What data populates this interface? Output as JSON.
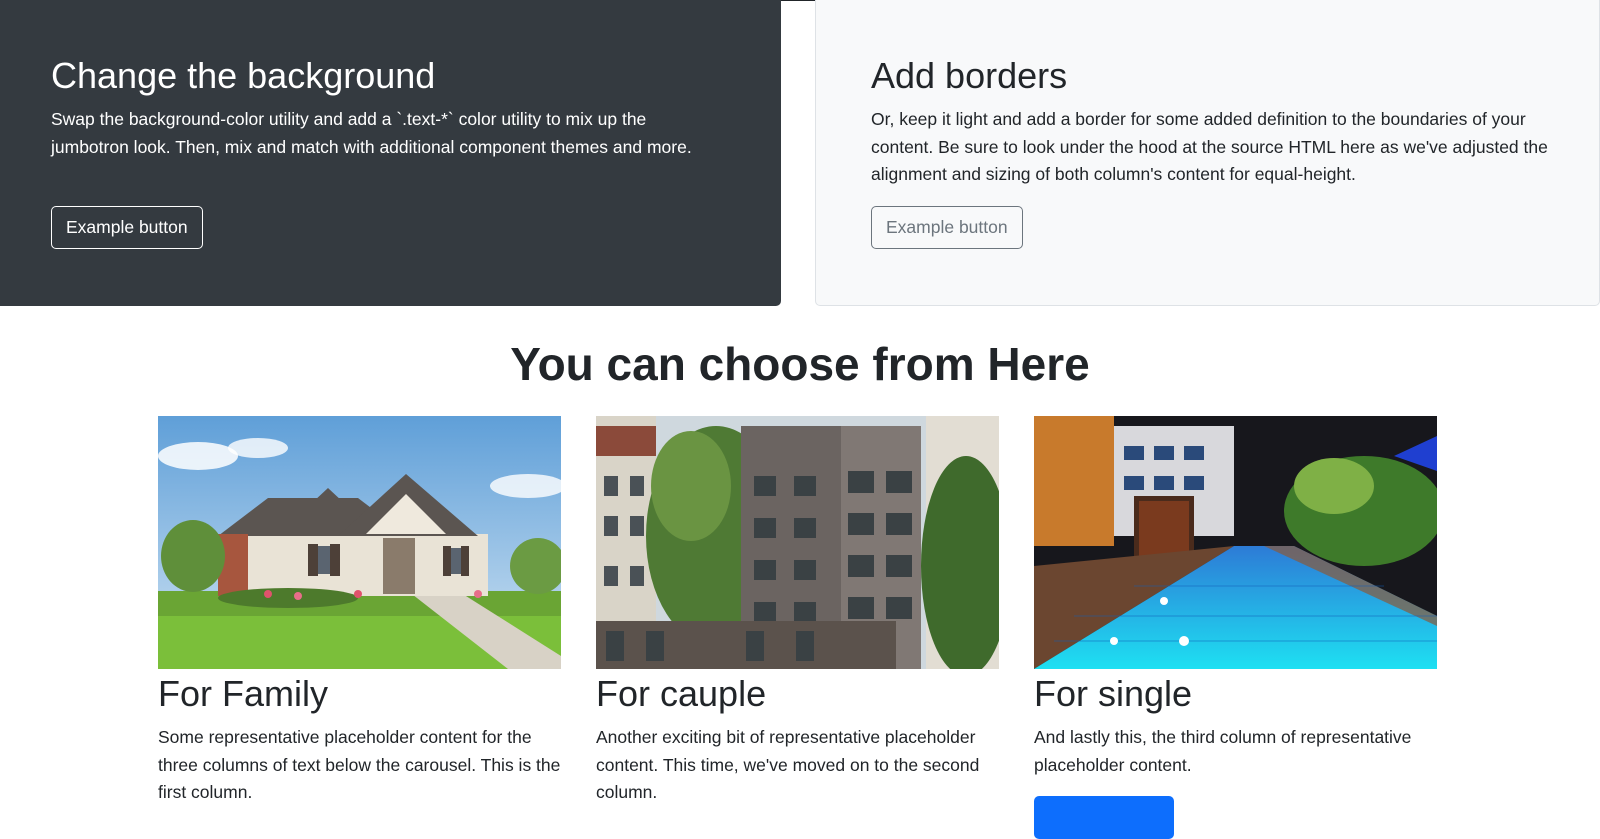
{
  "jumbotron_dark": {
    "title": "Change the background",
    "text": "Swap the background-color utility and add a `.text-*` color utility to mix up the jumbotron look. Then, mix and match with additional component themes and more.",
    "button_label": "Example button"
  },
  "jumbotron_light": {
    "title": "Add borders",
    "text": "Or, keep it light and add a border for some added definition to the boundaries of your content. Be sure to look under the hood at the source HTML here as we've adjusted the alignment and sizing of both column's content for equal-height.",
    "button_label": "Example button"
  },
  "section": {
    "heading": "You can choose from Here"
  },
  "cards": [
    {
      "title": "For Family",
      "text": "Some representative placeholder content for the three columns of text below the carousel. This is the first column."
    },
    {
      "title": "For cauple",
      "text": "Another exciting bit of representative placeholder content. This time, we've moved on to the second column."
    },
    {
      "title": "For single",
      "text": "And lastly this, the third column of representative placeholder content."
    }
  ],
  "colors": {
    "dark_panel": "#343a40",
    "light_panel": "#f8f9fa",
    "primary": "#0d6efd",
    "text": "#212529"
  }
}
